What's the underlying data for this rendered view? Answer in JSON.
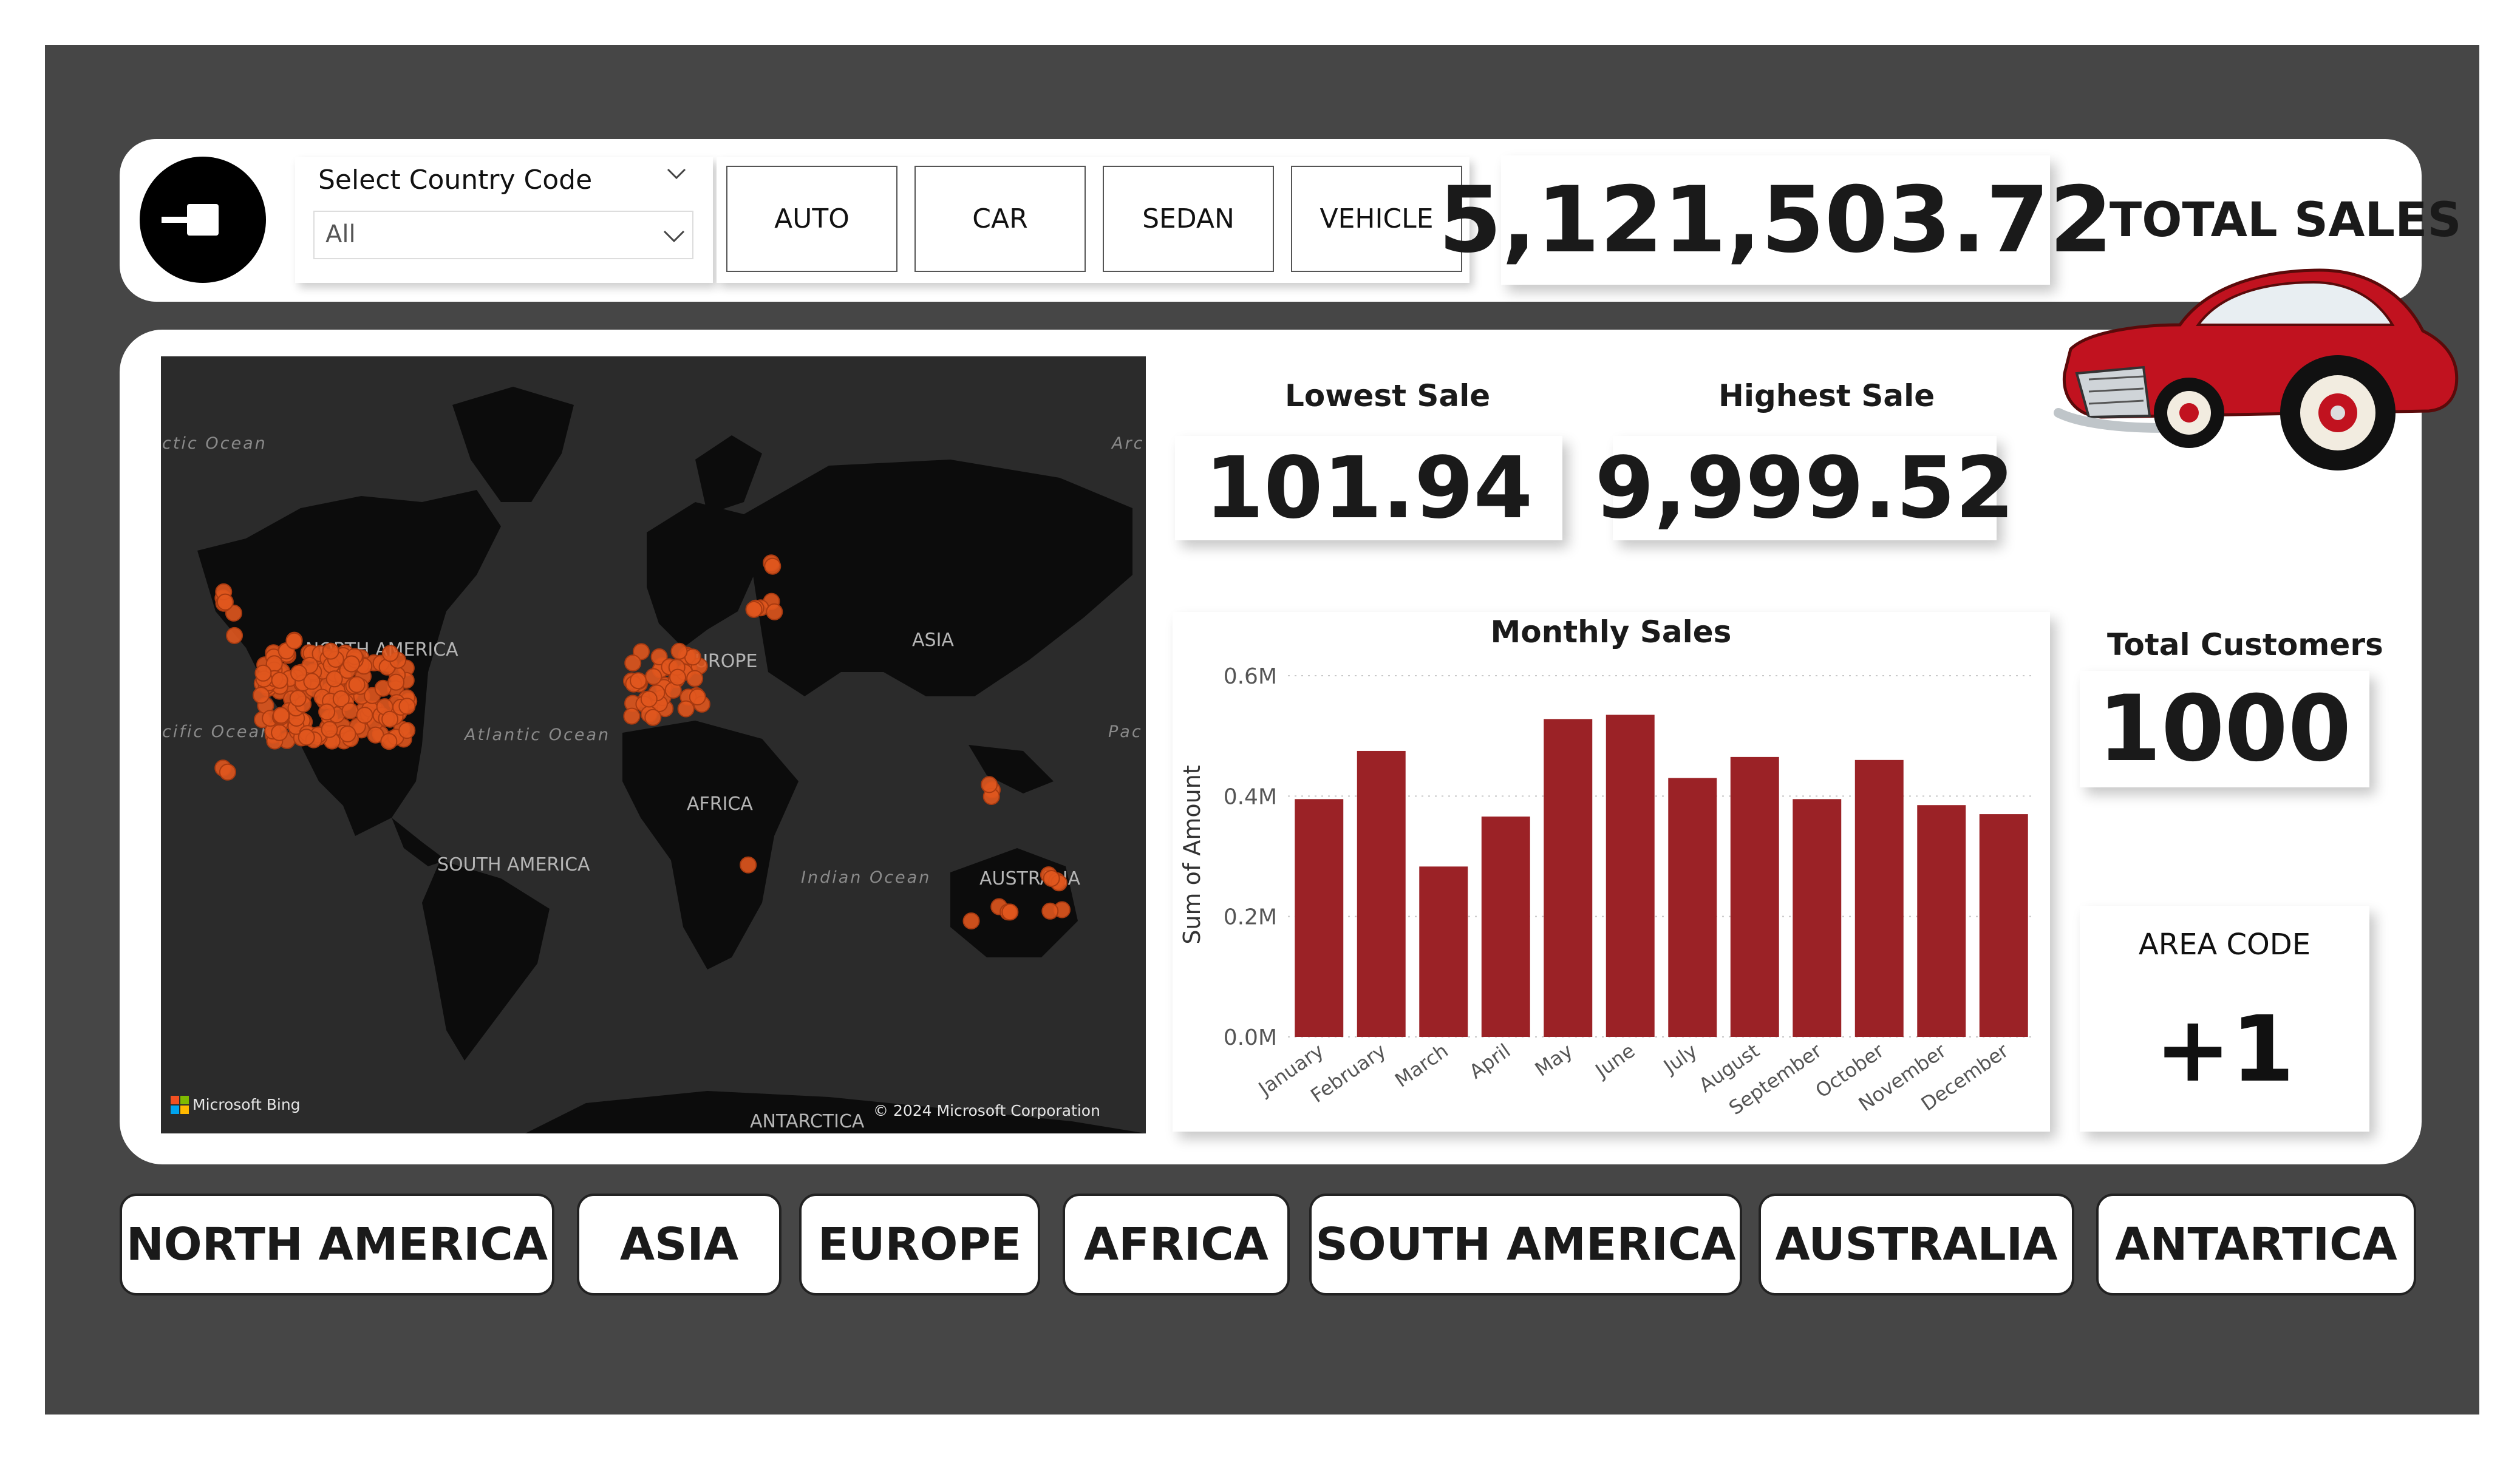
{
  "filters": {
    "country_title": "Select Country Code",
    "country_value": "All",
    "types": [
      "AUTO",
      "CAR",
      "SEDAN",
      "VEHICLE"
    ]
  },
  "kpis": {
    "total_sales_value": "5,121,503.72",
    "total_sales_label": "TOTAL SALES",
    "lowest_label": "Lowest Sale",
    "lowest_value": "101.94",
    "highest_label": "Highest Sale",
    "highest_value": "9,999.52",
    "customers_label": "Total Customers",
    "customers_value": "1000",
    "area_label": "AREA CODE",
    "area_value": "+1"
  },
  "map": {
    "labels": {
      "north_america": "NORTH AMERICA",
      "europe": "EUROPE",
      "asia": "ASIA",
      "africa": "AFRICA",
      "south_america": "SOUTH AMERICA",
      "australia": "AUSTRALIA",
      "antarctica": "ANTARCTICA",
      "arctic": "ctic Ocean",
      "arctic_right": "Arc",
      "pacific": "cific Ocean",
      "pacific_right": "Pac",
      "atlantic": "Atlantic Ocean",
      "indian": "Indian Ocean"
    },
    "attribution_brand": "Microsoft Bing",
    "copyright": "© 2024 Microsoft Corporation",
    "dot_color": "#e0561e"
  },
  "chart_data": {
    "type": "bar",
    "title": "Monthly Sales",
    "xlabel": "",
    "ylabel": "Sum of Amount",
    "categories": [
      "January",
      "February",
      "March",
      "April",
      "May",
      "June",
      "July",
      "August",
      "September",
      "October",
      "November",
      "December"
    ],
    "values": [
      0.395,
      0.475,
      0.283,
      0.366,
      0.528,
      0.535,
      0.43,
      0.465,
      0.395,
      0.46,
      0.385,
      0.37
    ],
    "unit": "M",
    "ylim": [
      0,
      0.6
    ],
    "yticks": [
      "0.0M",
      "0.2M",
      "0.4M",
      "0.6M"
    ],
    "grid": true,
    "color": "#9b2226"
  },
  "regions": [
    "NORTH AMERICA",
    "ASIA",
    "EUROPE",
    "AFRICA",
    "SOUTH AMERICA",
    "AUSTRALIA",
    "ANTARTICA"
  ]
}
